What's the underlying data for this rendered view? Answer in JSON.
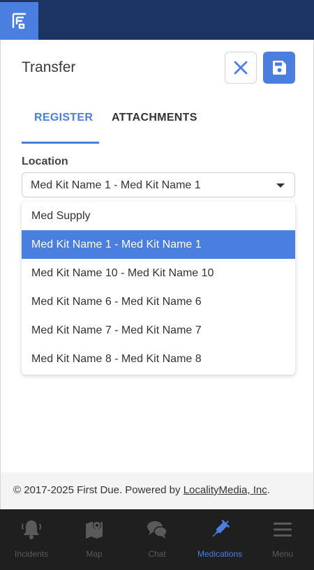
{
  "header": {
    "logo_icon": "first-due-logo-icon",
    "bg_color": "#1c3462",
    "accent": "#4a7fe0"
  },
  "form": {
    "title": "Transfer",
    "close_icon": "close-icon",
    "save_icon": "save-icon"
  },
  "tabs": [
    {
      "label": "REGISTER",
      "active": true
    },
    {
      "label": "ATTACHMENTS",
      "active": false
    }
  ],
  "location": {
    "label": "Location",
    "selected_value": "Med Kit Name 1 - Med Kit Name 1",
    "options": [
      {
        "label": "Med Supply",
        "selected": false
      },
      {
        "label": "Med Kit Name 1 - Med Kit Name 1",
        "selected": true
      },
      {
        "label": "Med Kit Name 10 - Med Kit Name 10",
        "selected": false
      },
      {
        "label": "Med Kit Name 6 - Med Kit Name 6",
        "selected": false
      },
      {
        "label": "Med Kit Name 7 - Med Kit Name 7",
        "selected": false
      },
      {
        "label": "Med Kit Name 8 - Med Kit Name 8",
        "selected": false
      }
    ]
  },
  "footer": {
    "text": "© 2017-2025 First Due. Powered by ",
    "link": "LocalityMedia, Inc",
    "suffix": "."
  },
  "bottom_nav": [
    {
      "label": "Incidents",
      "icon": "bell-icon",
      "active": false
    },
    {
      "label": "Map",
      "icon": "map-pin-icon",
      "active": false
    },
    {
      "label": "Chat",
      "icon": "chat-bubbles-icon",
      "active": false
    },
    {
      "label": "Medications",
      "icon": "syringe-icon",
      "active": true
    },
    {
      "label": "Menu",
      "icon": "hamburger-menu-icon",
      "active": false
    }
  ]
}
